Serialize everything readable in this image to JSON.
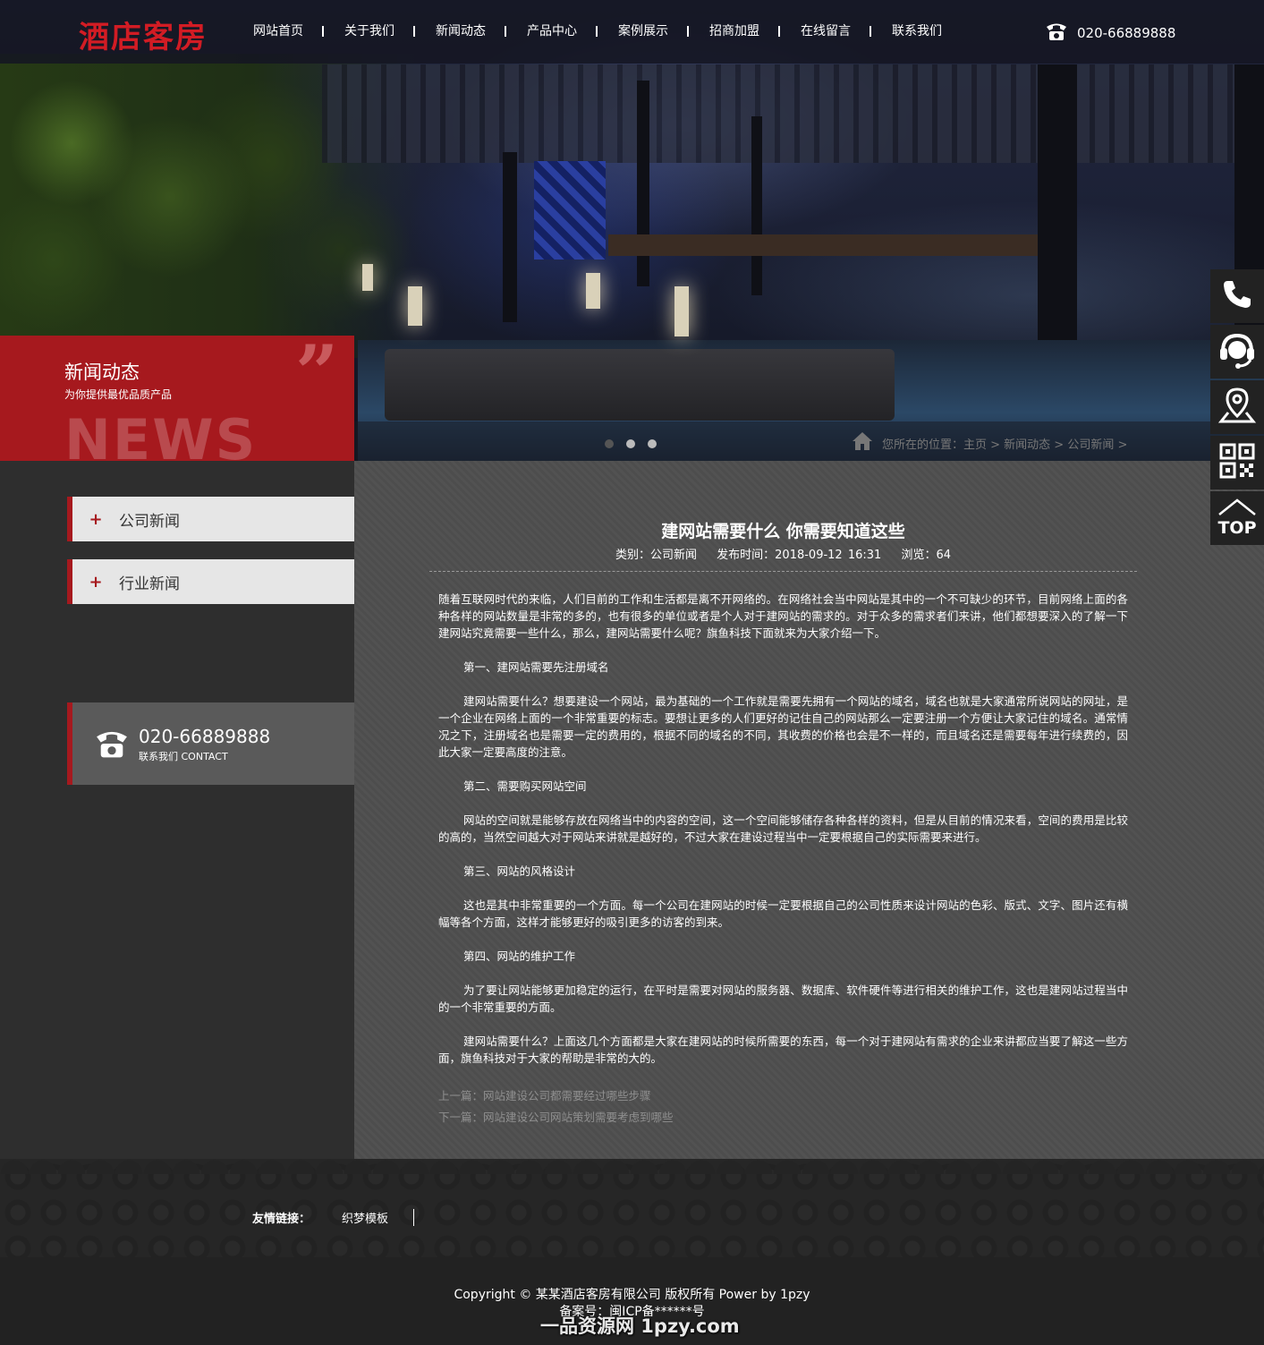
{
  "header": {
    "logo": "酒店客房",
    "nav": [
      "网站首页",
      "关于我们",
      "新闻动态",
      "产品中心",
      "案例展示",
      "招商加盟",
      "在线留言",
      "联系我们"
    ],
    "phone": "020-66889888"
  },
  "banner": {
    "section_title": "新闻动态",
    "section_subtitle": "为你提供最优品质产品",
    "section_en": "NEWS",
    "quote_mark": "”",
    "breadcrumb": "您所在的位置：主页 > 新闻动态 > 公司新闻 >",
    "slide_count": 3
  },
  "sidebar": {
    "categories": [
      "公司新闻",
      "行业新闻"
    ],
    "plus": "+",
    "contact_phone": "020-66889888",
    "contact_label": "联系我们 CONTACT"
  },
  "article": {
    "title": "建网站需要什么 你需要知道这些",
    "category": "类别：公司新闻",
    "date": "发布时间：2018-09-12 16:31",
    "views": "浏览：64",
    "paragraphs": [
      "随着互联网时代的来临，人们目前的工作和生活都是离不开网络的。在网络社会当中网站是其中的一个不可缺少的环节，目前网络上面的各种各样的网站数量是非常的多的，也有很多的单位或者是个人对于建网站的需求的。对于众多的需求者们来讲，他们都想要深入的了解一下建网站究竟需要一些什么，那么，建网站需要什么呢？旗鱼科技下面就来为大家介绍一下。",
      "第一、建网站需要先注册域名",
      "建网站需要什么？想要建设一个网站，最为基础的一个工作就是需要先拥有一个网站的域名，域名也就是大家通常所说网站的网址，是一个企业在网络上面的一个非常重要的标志。要想让更多的人们更好的记住自己的网站那么一定要注册一个方便让大家记住的域名。通常情况之下，注册域名也是需要一定的费用的，根据不同的域名的不同，其收费的价格也会是不一样的，而且域名还是需要每年进行续费的，因此大家一定要高度的注意。",
      "第二、需要购买网站空间",
      "网站的空间就是能够存放在网络当中的内容的空间，这一个空间能够储存各种各样的资料，但是从目前的情况来看，空间的费用是比较的高的，当然空间越大对于网站来讲就是越好的，不过大家在建设过程当中一定要根据自己的实际需要来进行。",
      "第三、网站的风格设计",
      "这也是其中非常重要的一个方面。每一个公司在建网站的时候一定要根据自己的公司性质来设计网站的色彩、版式、文字、图片还有横幅等各个方面，这样才能够更好的吸引更多的访客的到来。",
      "第四、网站的维护工作",
      "为了要让网站能够更加稳定的运行，在平时是需要对网站的服务器、数据库、软件硬件等进行相关的维护工作，这也是建网站过程当中的一个非常重要的方面。",
      "建网站需要什么？上面这几个方面都是大家在建网站的时候所需要的东西，每一个对于建网站有需求的企业来讲都应当要了解这一些方面，旗鱼科技对于大家的帮助是非常的大的。"
    ],
    "prev": "上一篇：网站建设公司都需要经过哪些步骤",
    "next": "下一篇：网站建设公司网站策划需要考虑到哪些"
  },
  "friend_links": {
    "label": "友情链接：",
    "links": [
      "织梦模板"
    ]
  },
  "footer": {
    "copyright": "Copyright © 某某酒店客房有限公司 版权所有 Power by 1pzy",
    "beian": "备案号：闽ICP备******号",
    "watermark": "一品资源网 1pzy.com"
  },
  "float_bar": {
    "icons": [
      "phone-icon",
      "customer-service-icon",
      "location-icon",
      "qrcode-icon",
      "top-icon"
    ],
    "top_label": "TOP"
  },
  "colors": {
    "brand_red": "#a6191e",
    "logo_red": "#d21c24",
    "header_bg": "#141622",
    "main_bg": "#505050",
    "sidebar_bg": "#2e2e2e",
    "footer_bg": "#222222"
  }
}
